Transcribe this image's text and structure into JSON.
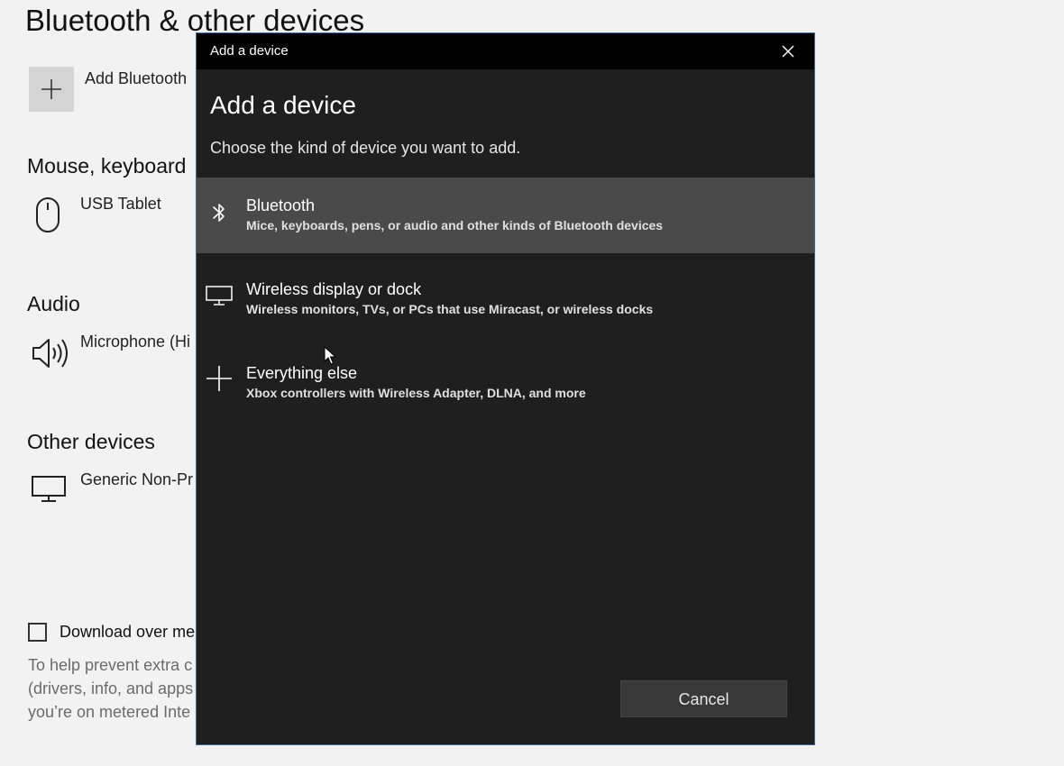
{
  "settings": {
    "title": "Bluetooth & other devices",
    "add_label": "Add Bluetooth",
    "sections": {
      "mouse": "Mouse, keyboard",
      "audio": "Audio",
      "other": "Other devices"
    },
    "devices": {
      "tablet": "USB Tablet",
      "microphone": "Microphone (Hi",
      "generic": "Generic Non-Pr"
    },
    "download_label": "Download over me",
    "help_lines": [
      "To help prevent extra c",
      "(drivers, info, and apps",
      "you’re on metered Inte"
    ]
  },
  "dialog": {
    "window_title": "Add a device",
    "heading": "Add a device",
    "subtitle": "Choose the kind of device you want to add.",
    "options": [
      {
        "title": "Bluetooth",
        "desc": "Mice, keyboards, pens, or audio and other kinds of Bluetooth devices",
        "icon": "bluetooth-icon",
        "selected": true
      },
      {
        "title": "Wireless display or dock",
        "desc": "Wireless monitors, TVs, or PCs that use Miracast, or wireless docks",
        "icon": "monitor-icon",
        "selected": false
      },
      {
        "title": "Everything else",
        "desc": "Xbox controllers with Wireless Adapter, DLNA, and more",
        "icon": "plus-icon",
        "selected": false
      }
    ],
    "cancel_label": "Cancel"
  },
  "colors": {
    "dialog_bg": "#1f1f1f",
    "titlebar_bg": "#000000",
    "selected_bg": "#4a4a4a",
    "dialog_border": "#3d6aa8",
    "page_bg": "#f2f2f2"
  }
}
